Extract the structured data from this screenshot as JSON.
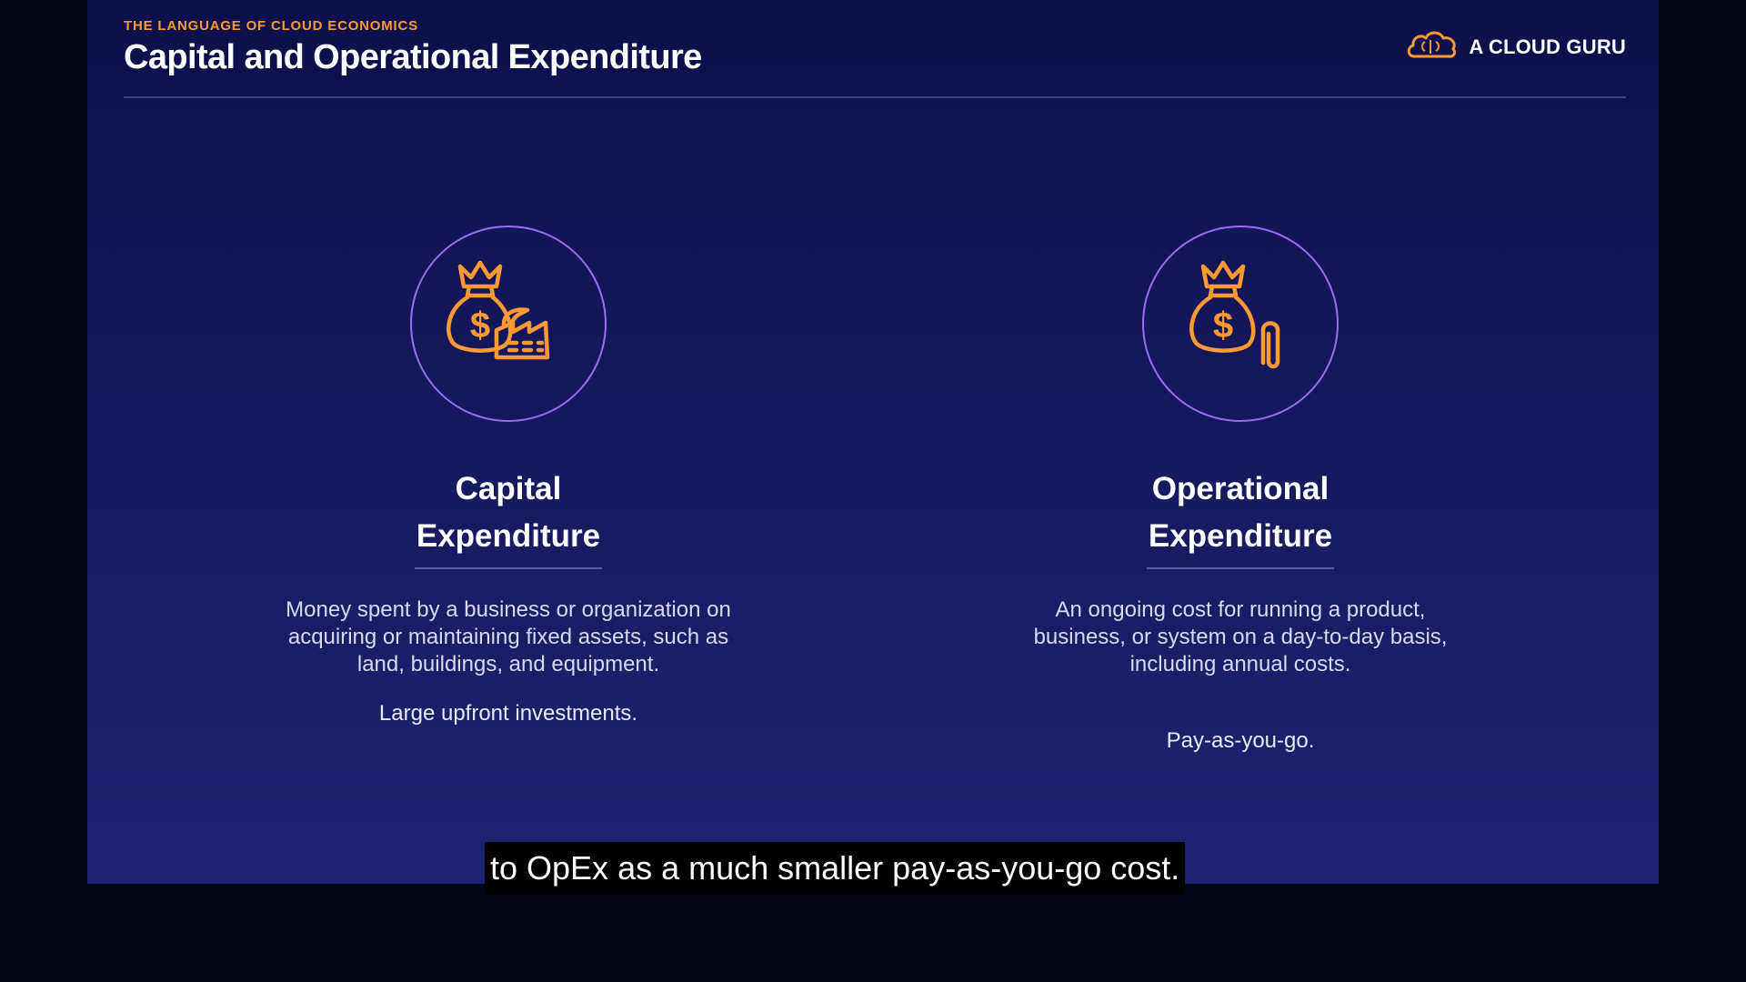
{
  "slide": {
    "kicker": "THE LANGUAGE OF CLOUD ECONOMICS",
    "title": "Capital and Operational Expenditure",
    "brand": "A CLOUD GURU"
  },
  "cards": [
    {
      "title_line1": "Capital",
      "title_line2": "Expenditure",
      "description": "Money spent by a business or organization on acquiring or maintaining fixed assets, such as land, buildings, and equipment.",
      "note": "Large upfront investments.",
      "icon": "money-bag-factory-icon"
    },
    {
      "title_line1": "Operational",
      "title_line2": "Expenditure",
      "description": "An ongoing cost for running a product, business, or system on a day-to-day basis, including annual costs.",
      "note": "Pay-as-you-go.",
      "icon": "money-bag-paperclip-icon"
    }
  ],
  "caption": "to OpEx as a much smaller pay-as-you-go cost.",
  "colors": {
    "accent": "#ff9933",
    "circle_border": "#9b6cf0",
    "slide_top": "#0d0f4a",
    "slide_bottom": "#1f2270"
  }
}
